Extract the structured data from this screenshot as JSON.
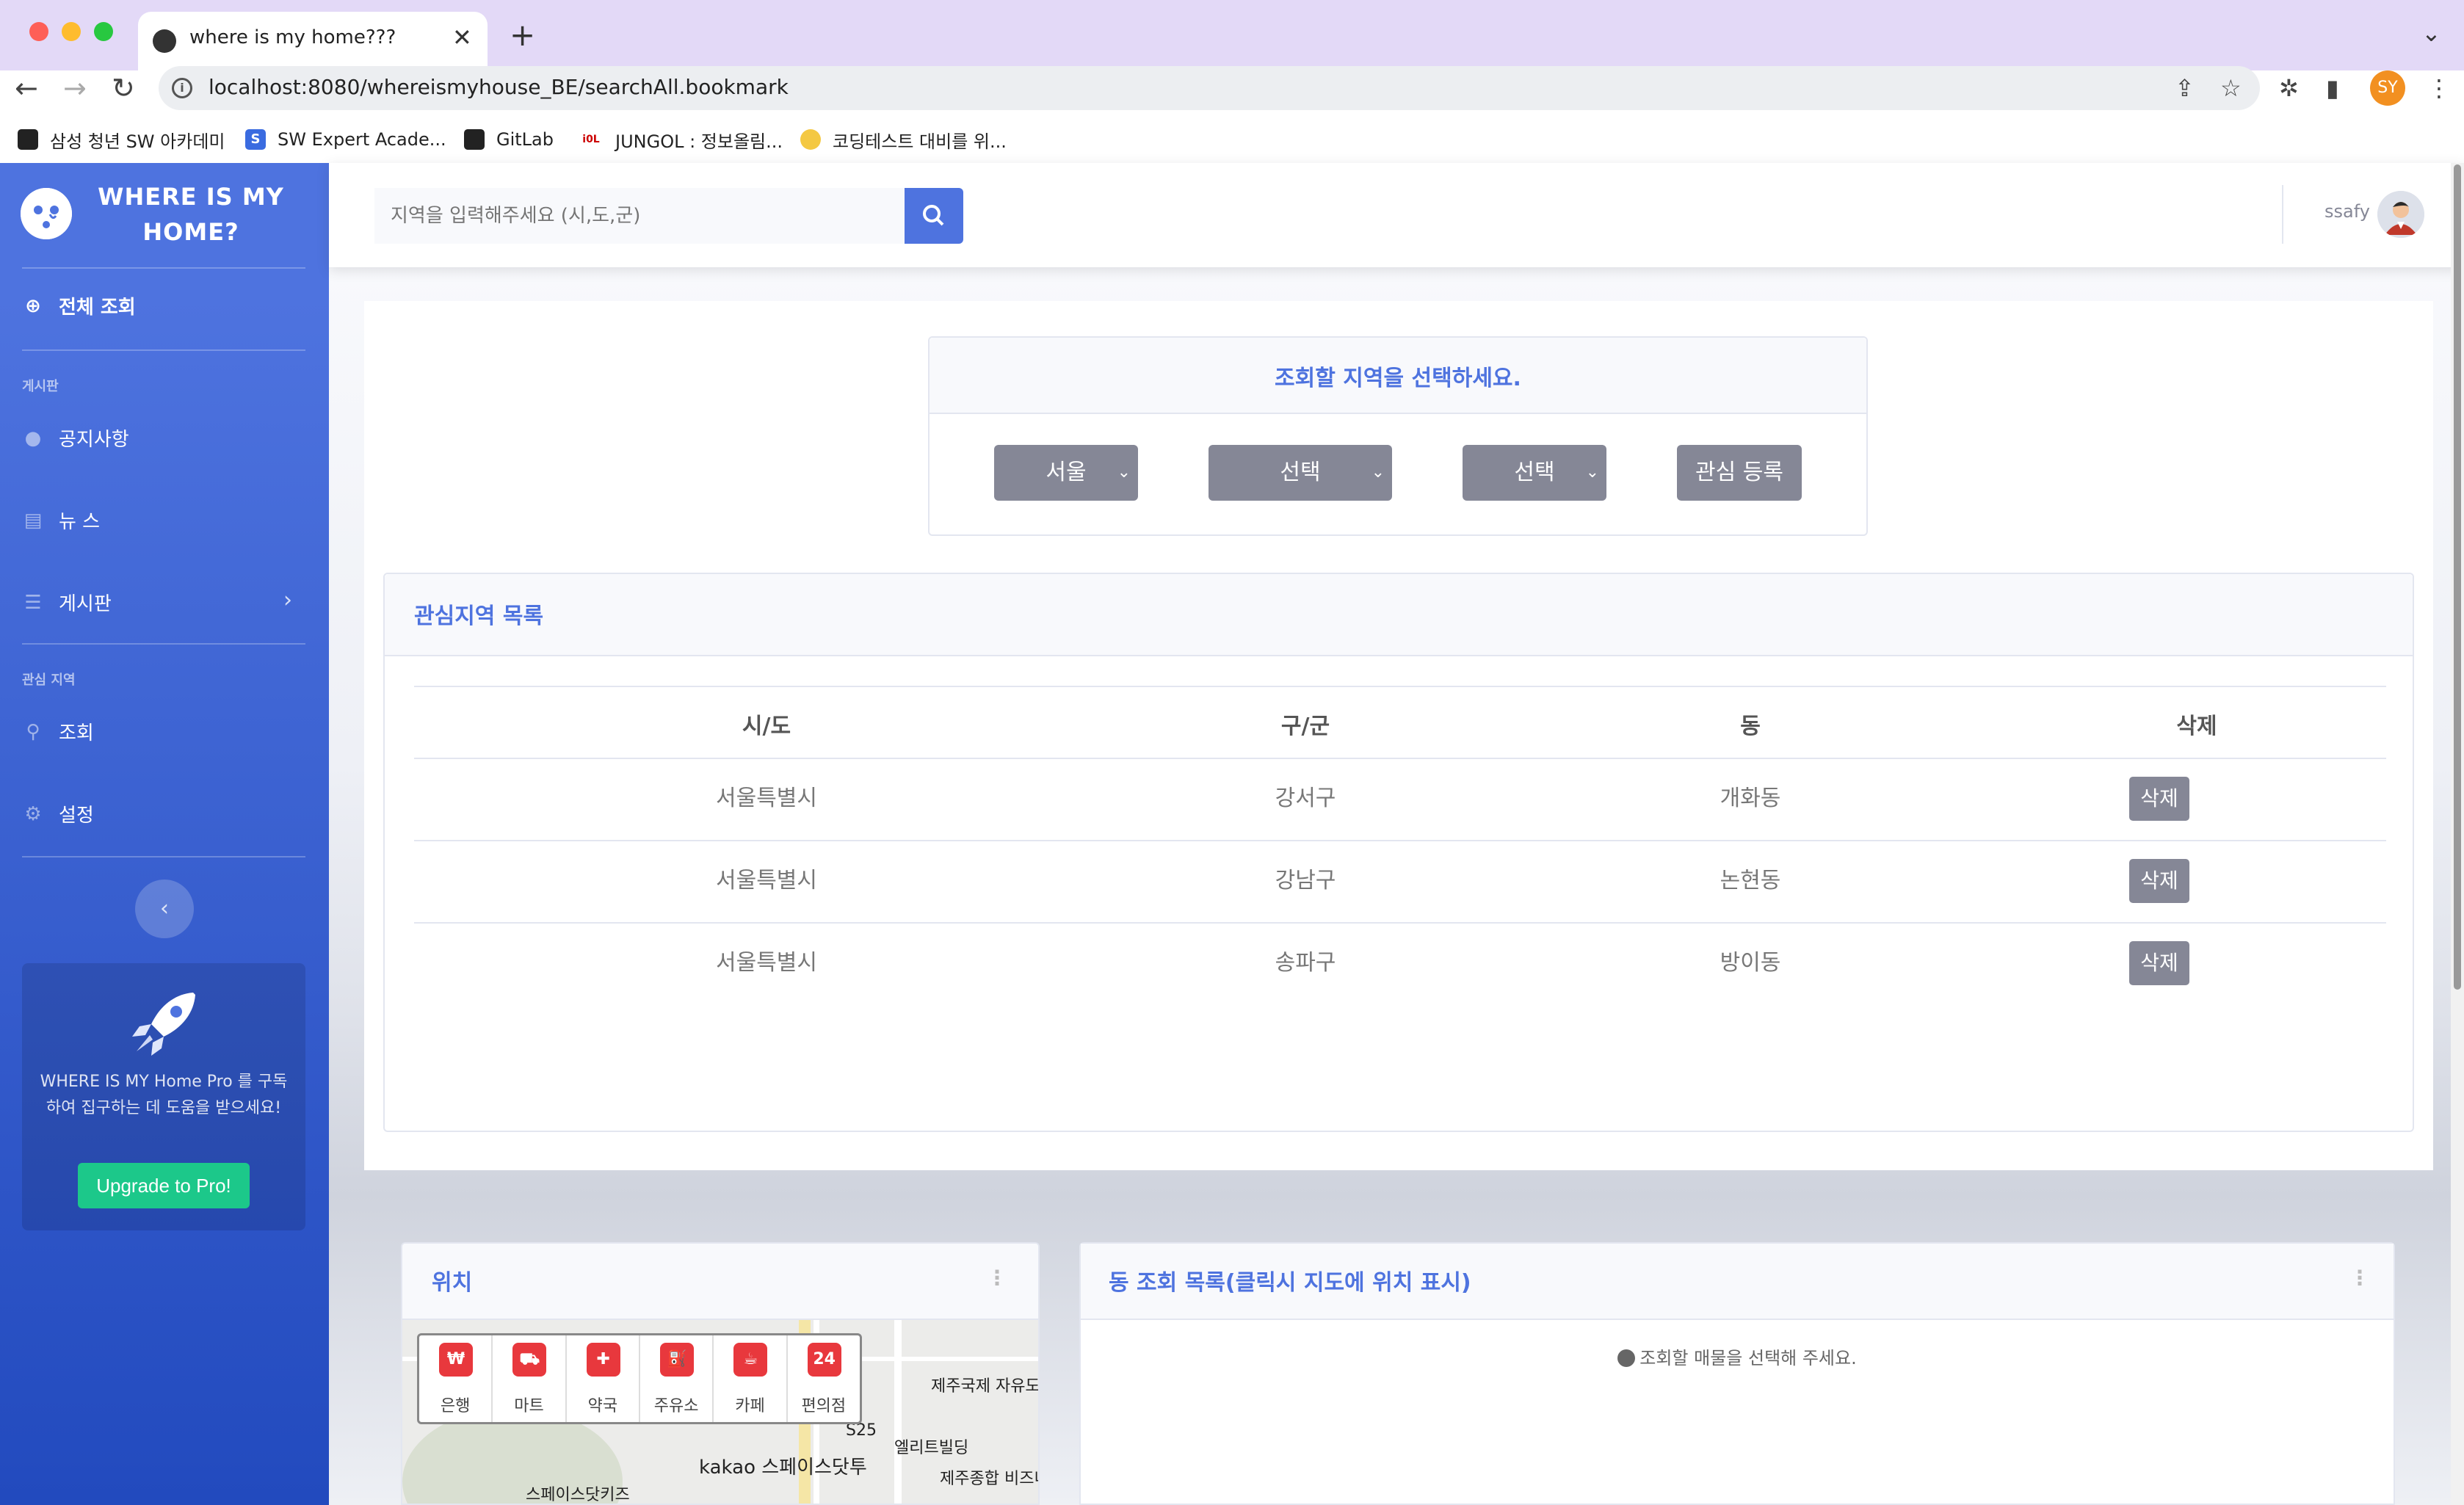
{
  "browser": {
    "tab_title": "where is my home???",
    "url": "localhost:8080/whereismyhouse_BE/searchAll.bookmark",
    "profile_initials": "SY",
    "bookmarks": [
      "삼성 청년 SW 아카데미",
      "SW Expert Acade...",
      "GitLab",
      "JUNGOL : 정보올림...",
      "코딩테스트 대비를 위..."
    ]
  },
  "sidebar": {
    "brand": "WHERE IS MY HOME?",
    "nav_all": "전체 조회",
    "section_board": "게시판",
    "notice": "공지사항",
    "news": "뉴 스",
    "board": "게시판",
    "section_interest": "관심 지역",
    "lookup": "조회",
    "settings": "설정",
    "promo_text": "WHERE IS MY Home Pro 를 구독하여 집구하는 데 도움을 받으세요!",
    "upgrade_label": "Upgrade to Pro!"
  },
  "topbar": {
    "search_placeholder": "지역을 입력해주세요 (시,도,군)",
    "username": "ssafy"
  },
  "region_select": {
    "title": "조회할 지역을 선택하세요.",
    "sido": "서울",
    "gugun": "선택",
    "dong": "선택",
    "register_label": "관심 등록"
  },
  "favorites": {
    "title": "관심지역 목록",
    "headers": [
      "시/도",
      "구/군",
      "동",
      "삭제"
    ],
    "rows": [
      {
        "sido": "서울특별시",
        "gugun": "강서구",
        "dong": "개화동",
        "delete": "삭제"
      },
      {
        "sido": "서울특별시",
        "gugun": "강남구",
        "dong": "논현동",
        "delete": "삭제"
      },
      {
        "sido": "서울특별시",
        "gugun": "송파구",
        "dong": "방이동",
        "delete": "삭제"
      }
    ]
  },
  "location": {
    "title": "위치",
    "categories": [
      "은행",
      "마트",
      "약국",
      "주유소",
      "카페",
      "편의점"
    ],
    "map_labels": [
      "제주국제 자유도시개발센",
      "S25",
      "엘리트빌딩",
      "kakao 스페이스닷투",
      "제주종합 비즈니스센",
      "스페이스닷키즈"
    ]
  },
  "dong_list": {
    "title": "동 조회 목록(클릭시 지도에 위치 표시)",
    "empty_message": "조회할 매물을 선택해 주세요."
  },
  "colors": {
    "primary": "#4e73df",
    "success": "#1cc88a",
    "secondary": "#858796"
  }
}
